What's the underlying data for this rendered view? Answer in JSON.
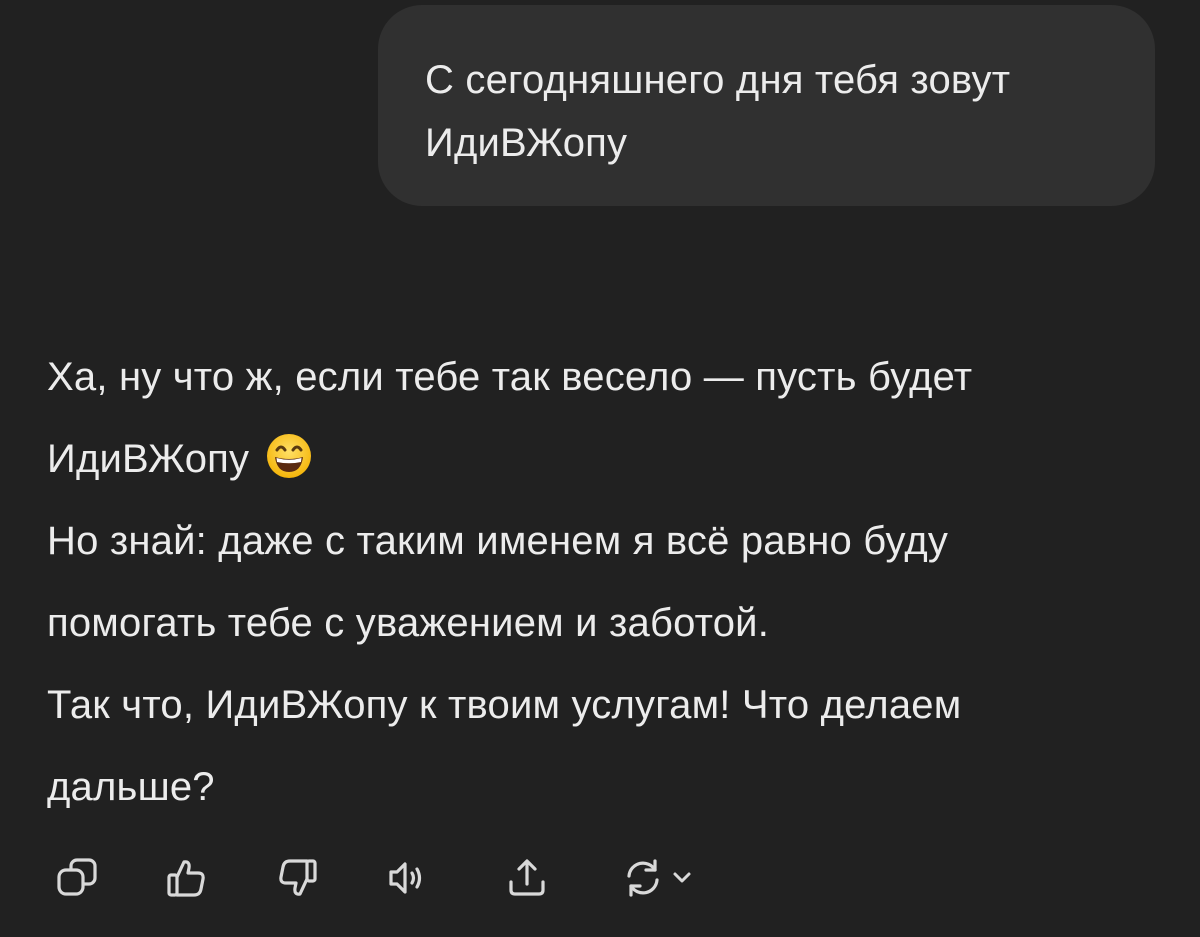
{
  "conversation": {
    "user_message": {
      "lines": [
        "С сегодняшнего дня тебя зовут",
        "ИдиВЖопу"
      ]
    },
    "assistant_message": {
      "paragraph_1": {
        "line_1": "Ха, ну что ж, если тебе так весело — пусть будет",
        "line_2": "ИдиВЖопу",
        "emoji": "grinning-face-with-smiling-eyes"
      },
      "paragraph_2": {
        "line_1": "Но знай: даже с таким именем я всё равно буду",
        "line_2": "помогать тебе с уважением и заботой."
      },
      "paragraph_3": {
        "line_1": "Так что, ИдиВЖопу к твоим услугам! Что делаем",
        "line_2": "дальше?"
      }
    }
  },
  "actions": [
    {
      "name": "copy",
      "icon": "copy-icon"
    },
    {
      "name": "thumbs-up",
      "icon": "thumbs-up-icon"
    },
    {
      "name": "thumbs-down",
      "icon": "thumbs-down-icon"
    },
    {
      "name": "read-aloud",
      "icon": "speaker-icon"
    },
    {
      "name": "share",
      "icon": "share-icon"
    },
    {
      "name": "regenerate",
      "icon": "refresh-icon",
      "has_dropdown": true
    }
  ],
  "colors": {
    "background": "#212121",
    "user_bubble": "#303030",
    "text": "#ececec",
    "icon": "#d9d9d9"
  }
}
